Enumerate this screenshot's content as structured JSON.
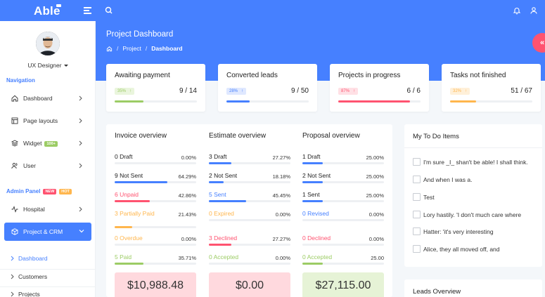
{
  "brand": {
    "name": "Able"
  },
  "banner": {
    "title": "Project Dashboard",
    "breadcrumb": [
      "Project",
      "Dashboard"
    ]
  },
  "user": {
    "role": "UX Designer"
  },
  "nav": {
    "caption_navigation": "Navigation",
    "items": [
      {
        "label": "Dashboard",
        "icon": "home-icon"
      },
      {
        "label": "Page layouts",
        "icon": "layout-icon"
      },
      {
        "label": "Widget",
        "icon": "layers-icon",
        "badge": "100+"
      },
      {
        "label": "User",
        "icon": "users-icon"
      }
    ],
    "caption_admin": "Admin Panel",
    "admin_badges": [
      "NEW",
      "HOT"
    ],
    "hospital": {
      "label": "Hospital",
      "icon": "activity-icon"
    },
    "active": {
      "label": "Project & CRM",
      "icon": "box-icon"
    },
    "sub_items": [
      "Dashboard",
      "Customers",
      "Projects"
    ]
  },
  "stats": [
    {
      "title": "Awaiting payment",
      "pill": "35%",
      "value": "9 / 14",
      "progress": 0.35,
      "color": "#9ccc65",
      "pill_bg": "#eaf5dd"
    },
    {
      "title": "Converted leads",
      "pill": "28%",
      "value": "9 / 50",
      "progress": 0.28,
      "color": "#4680ff",
      "pill_bg": "#dfe8ff"
    },
    {
      "title": "Projects in progress",
      "pill": "87%",
      "value": "6 / 6",
      "progress": 0.87,
      "color": "#ff5370",
      "pill_bg": "#ffe0e5"
    },
    {
      "title": "Tasks not finished",
      "pill": "32%",
      "value": "51 / 67",
      "progress": 0.32,
      "color": "#ffb64d",
      "pill_bg": "#fff0d9"
    }
  ],
  "invoice": {
    "title": "Invoice overview",
    "rows": [
      {
        "label": "0 Draft",
        "pct": "0.00%",
        "value": 0.0,
        "color": "#222222",
        "bar": "#4680ff"
      },
      {
        "label": "9 Not Sent",
        "pct": "64.29%",
        "value": 0.6429,
        "color": "#222222",
        "bar": "#4680ff"
      },
      {
        "label": "6 Unpaid",
        "pct": "42.86%",
        "value": 0.4286,
        "color": "#ff5370",
        "bar": "#ff5370"
      },
      {
        "label": "3 Partially Paid",
        "pct": "21.43%",
        "value": 0.2143,
        "color": "#ffb64d",
        "bar": "#ffb64d"
      },
      {
        "label": "0 Overdue",
        "pct": "0.00%",
        "value": 0.0,
        "color": "#ffb64d",
        "bar": "#ffb64d"
      },
      {
        "label": "5 Paid",
        "pct": "35.71%",
        "value": 0.3571,
        "color": "#9ccc65",
        "bar": "#9ccc65"
      }
    ],
    "total": "$10,988.48"
  },
  "estimate": {
    "title": "Estimate overview",
    "rows": [
      {
        "label": "3 Draft",
        "pct": "27.27%",
        "value": 0.2727,
        "color": "#222222",
        "bar": "#4680ff"
      },
      {
        "label": "2 Not Sent",
        "pct": "18.18%",
        "value": 0.1818,
        "color": "#222222",
        "bar": "#4680ff"
      },
      {
        "label": "5 Sent",
        "pct": "45.45%",
        "value": 0.4545,
        "color": "#4680ff",
        "bar": "#4680ff"
      },
      {
        "label": "0 Expired",
        "pct": "0.00%",
        "value": 0.0,
        "color": "#ffb64d",
        "bar": "#ffb64d"
      },
      {
        "label": "3 Declined",
        "pct": "27.27%",
        "value": 0.2727,
        "color": "#ff5370",
        "bar": "#ff5370"
      },
      {
        "label": "0 Accepted",
        "pct": "0.00%",
        "value": 0.0,
        "color": "#9ccc65",
        "bar": "#9ccc65"
      }
    ],
    "total": "$0.00"
  },
  "proposal": {
    "title": "Proposal overview",
    "rows": [
      {
        "label": "1 Draft",
        "pct": "25.00%",
        "value": 0.25,
        "color": "#222222",
        "bar": "#4680ff"
      },
      {
        "label": "2 Not Sent",
        "pct": "25.00%",
        "value": 0.25,
        "color": "#222222",
        "bar": "#4680ff"
      },
      {
        "label": "1 Sent",
        "pct": "25.00%",
        "value": 0.25,
        "color": "#222222",
        "bar": "#4680ff"
      },
      {
        "label": "0 Revised",
        "pct": "0.00%",
        "value": 0.0,
        "color": "#4680ff",
        "bar": "#4680ff"
      },
      {
        "label": "0 Declined",
        "pct": "0.00%",
        "value": 0.0,
        "color": "#ff5370",
        "bar": "#ff5370"
      },
      {
        "label": "0 Accepted",
        "pct": "25.00",
        "value": 0.25,
        "color": "#9ccc65",
        "bar": "#9ccc65"
      }
    ],
    "total": "$27,115.00"
  },
  "totals_colors": {
    "invoice": {
      "bg": "#ffd9de",
      "fg": "#333333"
    },
    "estimate": {
      "bg": "#ffd9de",
      "fg": "#333333"
    },
    "proposal": {
      "bg": "#e6f3d6",
      "fg": "#333333"
    }
  },
  "todo": {
    "title": "My To Do Items",
    "items": [
      "I'm sure _I_ shan't be able! I shall think.",
      "And when I was a.",
      "Test",
      "Lory hastily. 'I don't much care where",
      "Hatter: 'it's very interesting",
      "Alice, they all moved off, and"
    ]
  },
  "leads": {
    "title": "Leads Overview"
  },
  "colors": {
    "primary": "#4680ff",
    "danger": "#ff5370",
    "warning": "#ffb64d",
    "success": "#9ccc65"
  }
}
